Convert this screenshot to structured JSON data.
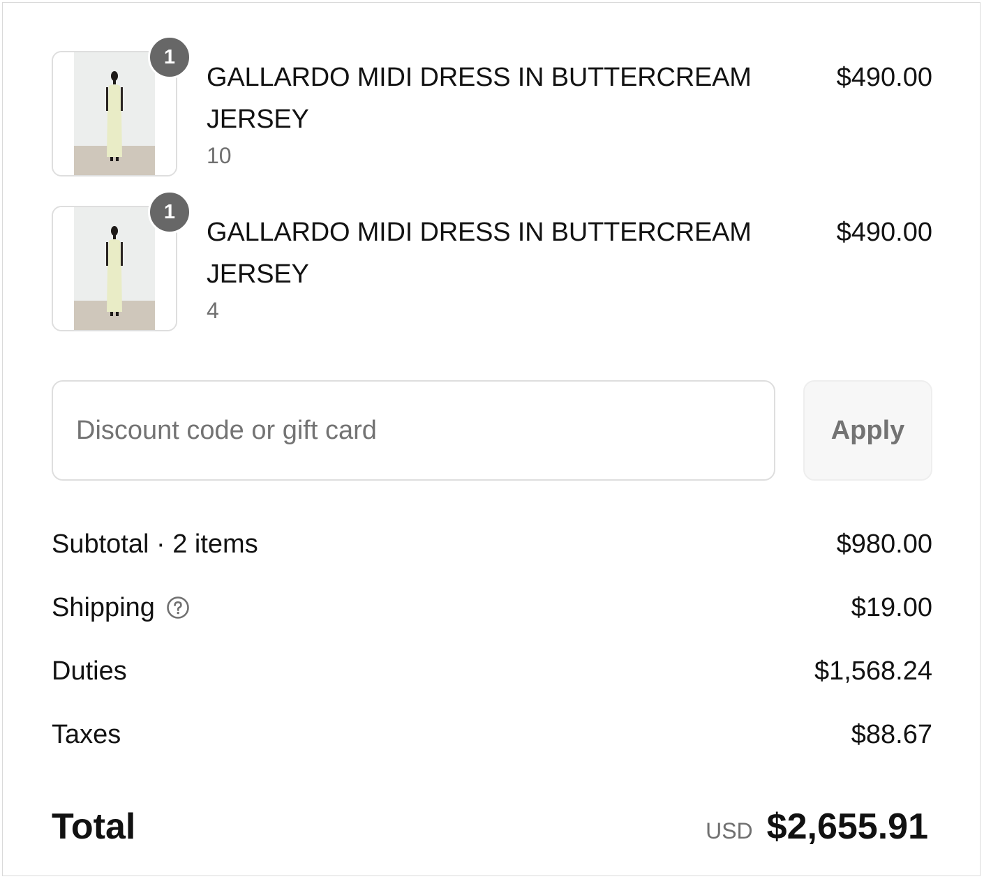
{
  "line_items": [
    {
      "quantity": "1",
      "title": "GALLARDO MIDI DRESS IN BUTTERCREAM JERSEY",
      "variant": "10",
      "price": "$490.00"
    },
    {
      "quantity": "1",
      "title": "GALLARDO MIDI DRESS IN BUTTERCREAM JERSEY",
      "variant": "4",
      "price": "$490.00"
    }
  ],
  "discount": {
    "placeholder": "Discount code or gift card",
    "apply_label": "Apply"
  },
  "summary": {
    "subtotal_label": "Subtotal · 2 items",
    "subtotal_value": "$980.00",
    "shipping_label": "Shipping",
    "shipping_value": "$19.00",
    "duties_label": "Duties",
    "duties_value": "$1,568.24",
    "taxes_label": "Taxes",
    "taxes_value": "$88.67"
  },
  "total": {
    "label": "Total",
    "currency": "USD",
    "amount": "$2,655.91"
  },
  "colors": {
    "badge": "#676767",
    "muted_text": "#707070",
    "border": "#dedede",
    "button_bg": "#f7f7f7"
  },
  "icons": {
    "shipping_help": "question-circle-icon"
  }
}
